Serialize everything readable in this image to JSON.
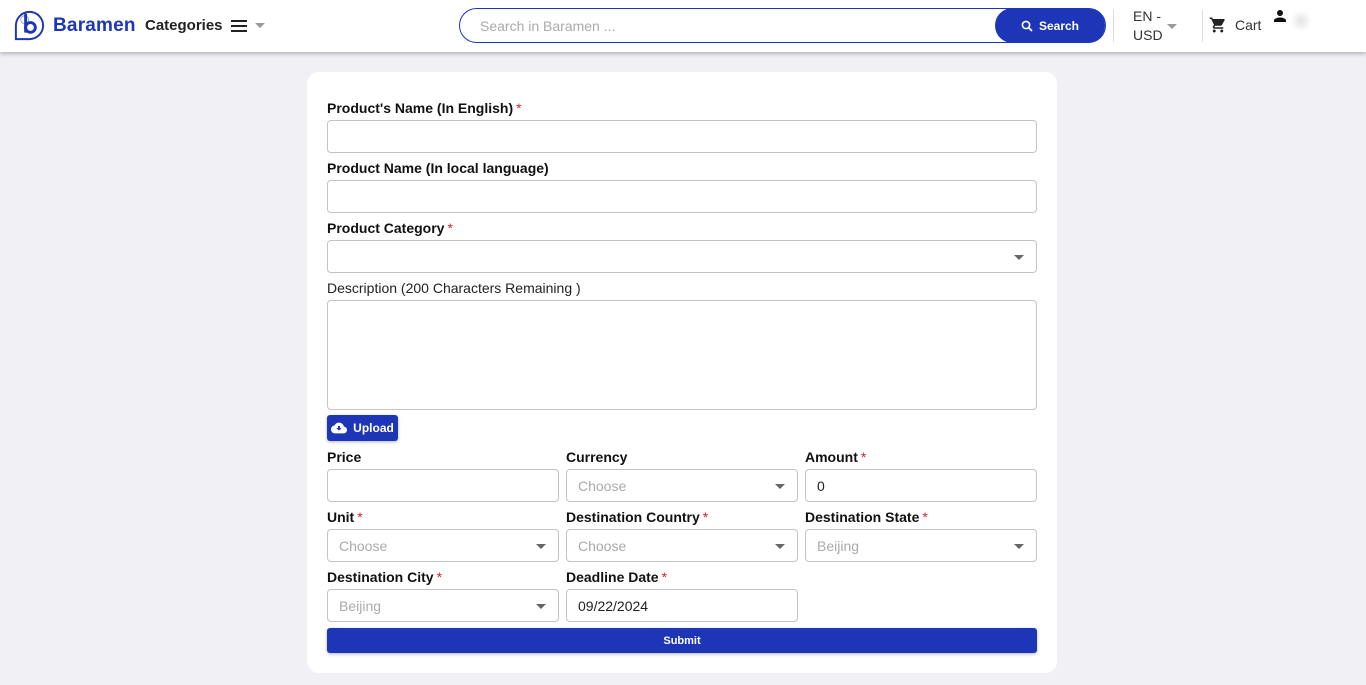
{
  "header": {
    "brand": "Baramen",
    "categories_label": "Categories",
    "search_placeholder": "Search in Baramen ...",
    "search_value": "",
    "search_button": "Search",
    "lang_line1": "EN -",
    "lang_line2": "USD",
    "cart_label": "Cart",
    "brand_color": "#1d36b8"
  },
  "form": {
    "product_name_en": {
      "label": "Product's Name (In English)",
      "required": "*",
      "value": ""
    },
    "product_name_local": {
      "label": "Product Name (In local language)",
      "value": ""
    },
    "product_category": {
      "label": "Product Category",
      "required": "*",
      "value": ""
    },
    "description": {
      "label": "Description (200 Characters Remaining )",
      "value": ""
    },
    "upload_button": "Upload",
    "price": {
      "label": "Price",
      "value": ""
    },
    "currency": {
      "label": "Currency",
      "value": "Choose"
    },
    "amount": {
      "label": "Amount",
      "required": "*",
      "value": "0"
    },
    "unit": {
      "label": "Unit",
      "required": "*",
      "value": "Choose"
    },
    "destination_country": {
      "label": "Destination Country",
      "required": "*",
      "value": "Choose"
    },
    "destination_state": {
      "label": "Destination State",
      "required": "*",
      "value": "Beijing"
    },
    "destination_city": {
      "label": "Destination City",
      "required": "*",
      "value": "Beijing"
    },
    "deadline_date": {
      "label": "Deadline Date",
      "required": "*",
      "value": "09/22/2024"
    },
    "submit_button": "Submit"
  }
}
